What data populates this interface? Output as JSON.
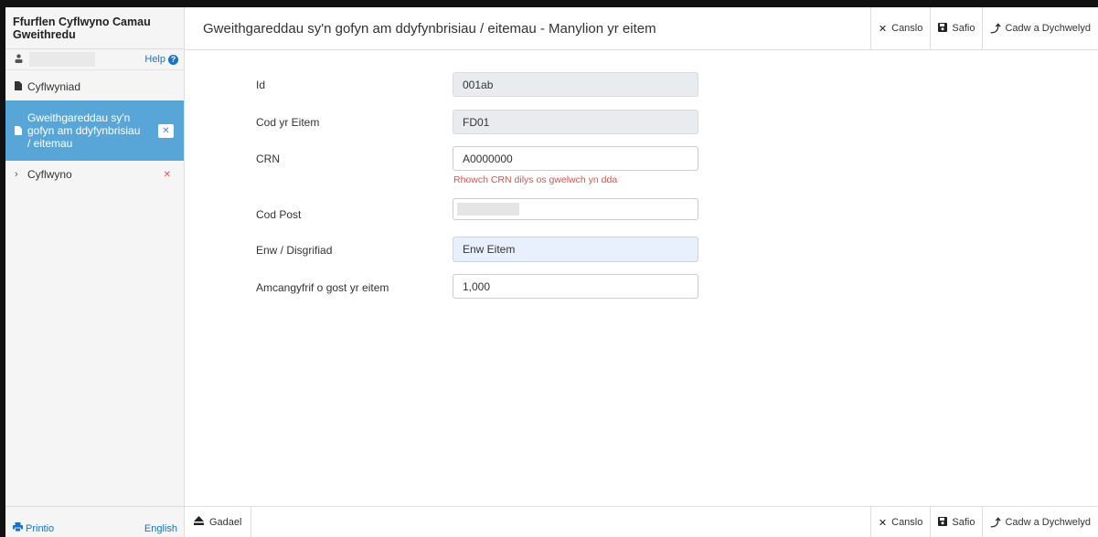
{
  "app": {
    "title": "Ffurflen Cyflwyno Camau Gweithredu"
  },
  "user": {
    "help_label": "Help"
  },
  "sidebar": {
    "items": [
      {
        "label": "Cyflwyniad"
      },
      {
        "label": "Gweithgareddau sy'n gofyn am ddyfynbrisiau / eitemau"
      },
      {
        "label": "Cyflwyno"
      }
    ]
  },
  "footer": {
    "print_label": "Printio",
    "language_label": "English",
    "exit_label": "Gadael"
  },
  "header": {
    "title": "Gweithgareddau sy'n gofyn am ddyfynbrisiau / eitemau - Manylion yr eitem",
    "cancel_label": "Canslo",
    "save_label": "Safio",
    "save_return_label": "Cadw a Dychwelyd"
  },
  "form": {
    "id": {
      "label": "Id",
      "value": "001ab"
    },
    "item_code": {
      "label": "Cod yr Eitem",
      "value": "FD01"
    },
    "crn": {
      "label": "CRN",
      "value": "A0000000",
      "error": "Rhowch CRN dilys os gwelwch yn dda"
    },
    "postcode": {
      "label": "Cod Post",
      "value": ""
    },
    "name": {
      "label": "Enw / Disgrifiad",
      "value": "Enw Eitem"
    },
    "cost": {
      "label": "Amcangyfrif o gost yr eitem",
      "value": "1,000"
    }
  },
  "colors": {
    "accent": "#58a6d8",
    "link": "#1a73c9",
    "error": "#d9534f"
  },
  "icons": [
    "user-icon",
    "help-icon",
    "document-icon",
    "chevron-right-icon",
    "close-icon",
    "save-icon",
    "return-icon",
    "print-icon",
    "eject-icon"
  ]
}
